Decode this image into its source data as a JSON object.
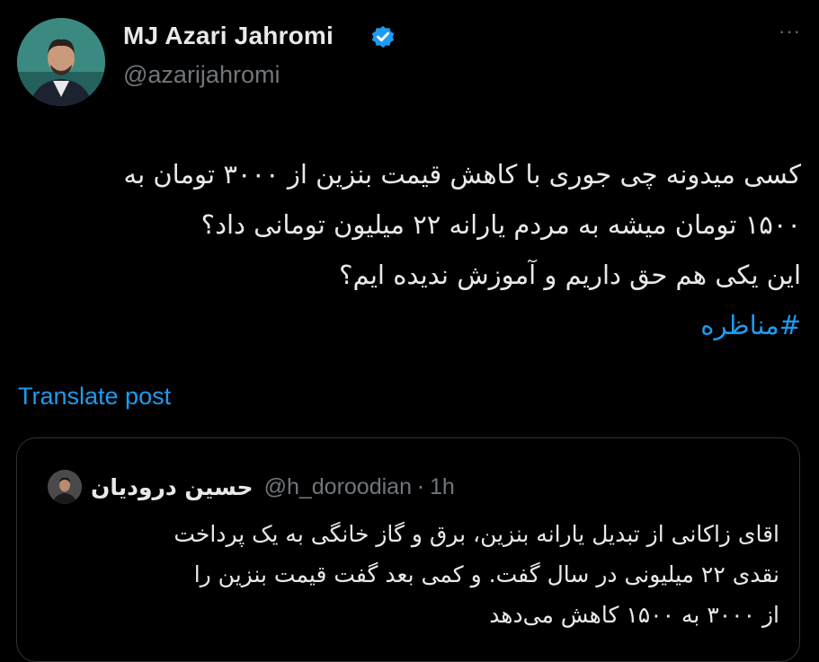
{
  "author": {
    "name": "MJ Azari Jahromi",
    "handle": "@azarijahromi",
    "avatar_icon": "person-avatar"
  },
  "more_label": "···",
  "tweet": {
    "lines": [
      "کسی میدونه چی جوری با کاهش قیمت بنزین از ۳۰۰۰ تومان به",
      "۱۵۰۰ تومان میشه به مردم یارانه ۲۲ میلیون تومانی داد؟",
      "این یکی هم حق داریم و آموزش ندیده ایم؟"
    ],
    "hashtag": "#مناظره"
  },
  "translate_label": "Translate post",
  "quote": {
    "name": "حسین درودیان",
    "handle": "@h_doroodian",
    "separator": "·",
    "time": "1h",
    "lines": [
      "اقای زاکانی از تبدیل یارانه بنزین، برق و گاز خانگی به یک پرداخت",
      "نقدی ۲۲ میلیونی در سال گفت. و کمی بعد گفت قیمت بنزین را",
      "از ۳۰۰۰ به ۱۵۰۰ کاهش می‌دهد"
    ]
  },
  "colors": {
    "background": "#000000",
    "text": "#e7e9ea",
    "secondary": "#71767b",
    "accent": "#1d9bf0",
    "border": "#2f3336"
  }
}
